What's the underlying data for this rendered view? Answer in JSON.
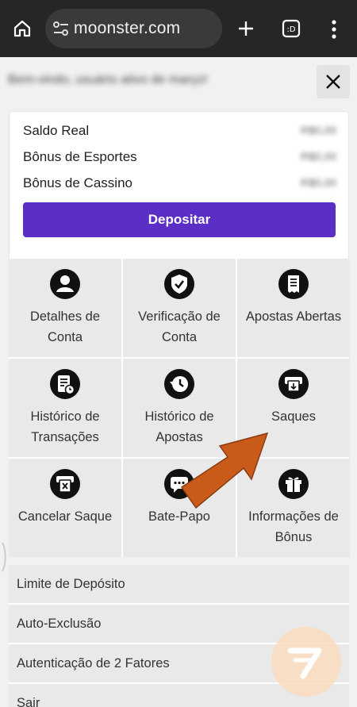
{
  "browser": {
    "url": "moonster.com",
    "icons": [
      "home-icon",
      "site-settings-icon",
      "new-tab-plus-icon",
      "tab-switcher-icon",
      "more-menu-icon"
    ]
  },
  "header": {
    "greeting": "Bem-vindo, usuário ativo de março!",
    "close_icon": "close-icon"
  },
  "balances": {
    "items": [
      {
        "label": "Saldo Real",
        "amount": "R$0,00"
      },
      {
        "label": "Bônus de Esportes",
        "amount": "R$0,00"
      },
      {
        "label": "Bônus de Cassino",
        "amount": "R$0,00"
      }
    ],
    "deposit_label": "Depositar",
    "accent": "#5b2fc5"
  },
  "grid": {
    "tiles": [
      {
        "label": "Detalhes de Conta",
        "icon": "account-icon"
      },
      {
        "label": "Verificação de Conta",
        "icon": "verified-shield-icon"
      },
      {
        "label": "Apostas Abertas",
        "icon": "receipt-icon"
      },
      {
        "label": "Histórico de Transações",
        "icon": "transaction-history-icon"
      },
      {
        "label": "Histórico de Apostas",
        "icon": "bet-history-icon"
      },
      {
        "label": "Saques",
        "icon": "withdrawal-icon"
      },
      {
        "label": "Cancelar Saque",
        "icon": "cancel-withdrawal-icon"
      },
      {
        "label": "Bate-Papo",
        "icon": "chat-icon"
      },
      {
        "label": "Informações de Bônus",
        "icon": "gift-icon"
      }
    ]
  },
  "list": {
    "items": [
      {
        "label": "Limite de Depósito"
      },
      {
        "label": "Auto-Exclusão"
      },
      {
        "label": "Autenticação de 2 Fatores"
      },
      {
        "label": "Sair"
      }
    ]
  },
  "overlay": {
    "arrow_color": "#c85a1a",
    "watermark_icon": "logo-watermark-icon"
  }
}
